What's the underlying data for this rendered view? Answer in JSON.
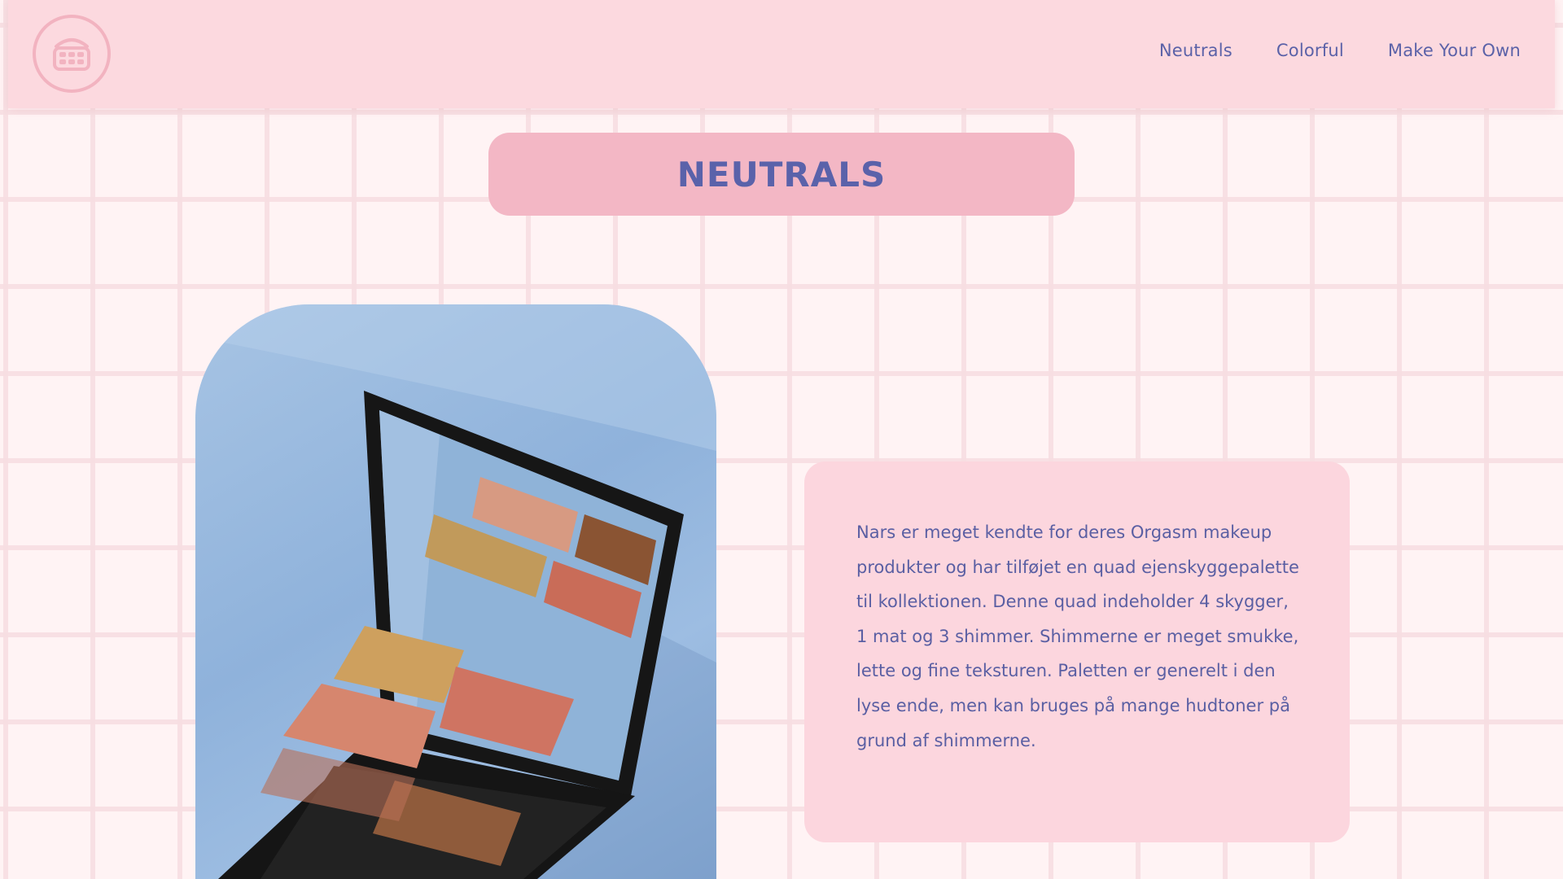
{
  "header": {
    "logo_icon": "eyeshadow-palette-icon",
    "nav": [
      {
        "label": "Neutrals"
      },
      {
        "label": "Colorful"
      },
      {
        "label": "Make Your Own"
      }
    ]
  },
  "page_title": "NEUTRALS",
  "product": {
    "image_icon": "eyeshadow-quad-photo",
    "description": "Nars er meget kendte for deres Orgasm makeup produkter og har tilføjet en quad ejenskyggepalette til kollektionen. Denne quad indeholder 4 skygger, 1 mat og 3 shimmer. Shimmerne er meget smukke, lette og fine teksturen. Paletten er generelt i den lyse ende, men kan bruges på mange hudtoner på grund af shimmerne."
  },
  "colors": {
    "header_bg": "#fcd9df",
    "accent_text": "#5a62aa",
    "title_pill": "#f3b7c5",
    "card_bg": "#fcd6de",
    "photo_bg": "#9dbde2"
  }
}
